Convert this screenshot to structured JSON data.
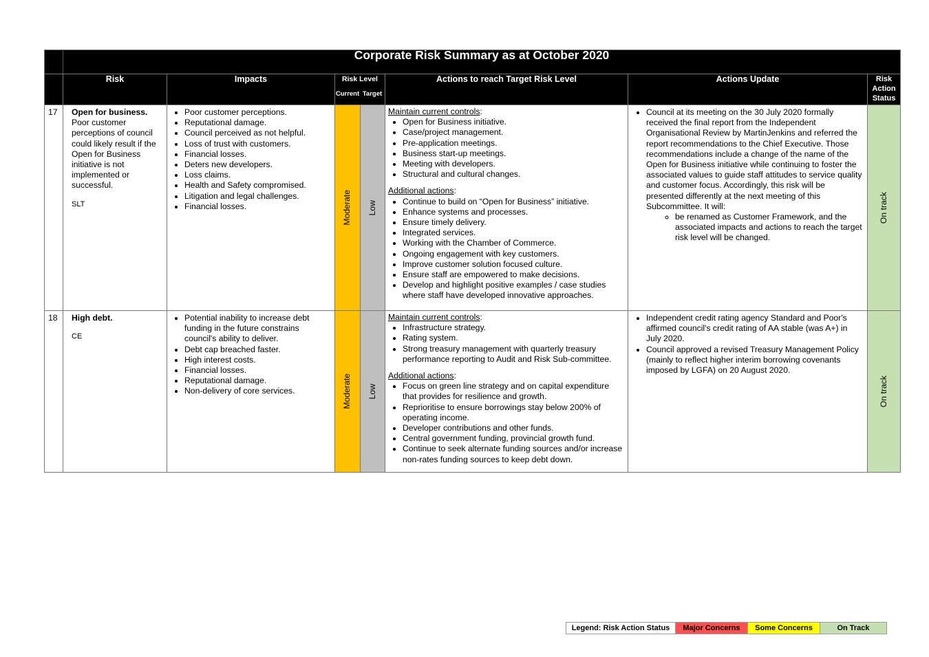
{
  "title": "Corporate Risk Summary as at October 2020",
  "headers": {
    "risk": "Risk",
    "impacts": "Impacts",
    "risk_level": "Risk Level",
    "current": "Current",
    "target": "Target",
    "actions": "Actions to reach Target Risk Level",
    "update": "Actions Update",
    "status": "Risk Action Status"
  },
  "rows": [
    {
      "number": "17",
      "risk_title": "Open for business.",
      "risk_desc": "Poor customer perceptions of council could likely result if the Open for Business initiative is not implemented or successful.",
      "owner": "SLT",
      "impacts": [
        "Poor customer perceptions.",
        "Reputational damage.",
        "Council perceived as not helpful.",
        "Loss of trust with customers.",
        "Financial losses.",
        "Deters new developers.",
        "Loss claims.",
        "Health and Safety compromised.",
        "Litigation and legal challenges.",
        "Financial losses."
      ],
      "current": "Moderate",
      "target": "Low",
      "controls_label": "Maintain current controls",
      "controls": [
        "Open for Business initiative.",
        "Case/project management.",
        "Pre-application meetings.",
        "Business start-up meetings.",
        "Meeting with developers.",
        "Structural and cultural changes."
      ],
      "additional_label": "Additional actions",
      "additional": [
        "Continue to build on “Open for Business” initiative.",
        "Enhance systems and processes.",
        "Ensure timely delivery.",
        "Integrated services.",
        "Working with the Chamber of Commerce.",
        "Ongoing engagement with key customers.",
        "Improve customer solution focused culture.",
        "Ensure staff are empowered to make decisions.",
        "Develop and highlight positive examples / case studies where staff have developed innovative approaches."
      ],
      "updates": [
        "Council at its meeting on the 30 July 2020 formally received the final report from the Independent Organisational Review by MartinJenkins and referred the report recommendations to the Chief Executive. Those recommendations include a change of the name of the Open for Business initiative while continuing to foster the associated values to guide staff attitudes to service quality and customer focus. Accordingly, this risk will be presented differently at the next meeting of this Subcommittee.  It will:"
      ],
      "sub_updates": [
        "be renamed as Customer Framework, and the associated impacts and actions to reach the target risk level will be changed."
      ],
      "status": "On track"
    },
    {
      "number": "18",
      "risk_title": "High debt.",
      "risk_desc": "",
      "owner": "CE",
      "impacts": [
        "Potential inability to increase debt funding in the future constrains council's ability to deliver.",
        "Debt cap breached faster.",
        "High interest costs.",
        "Financial losses.",
        "Reputational damage.",
        "Non-delivery of core services."
      ],
      "current": "Moderate",
      "target": "Low",
      "controls_label": "Maintain current controls",
      "controls": [
        "Infrastructure strategy.",
        "Rating system.",
        "Strong treasury management with quarterly treasury performance reporting to Audit and Risk Sub-committee."
      ],
      "additional_label": "Additional actions",
      "additional": [
        "Focus on green line strategy and on capital expenditure that provides for resilience and growth.",
        "Reprioritise to ensure borrowings stay below 200% of operating income.",
        "Developer contributions and other funds.",
        "Central government funding, provincial growth fund.",
        "Continue to seek alternate funding sources and/or increase non-rates funding sources to keep debt down."
      ],
      "updates": [
        "Independent credit rating agency Standard and Poor's affirmed council's credit rating of AA stable (was A+) in July 2020.",
        "Council approved a revised Treasury Management Policy (mainly to reflect higher interim borrowing covenants imposed by LGFA) on 20 August 2020."
      ],
      "sub_updates": [],
      "status": "On track"
    }
  ],
  "legend": {
    "label": "Legend: Risk Action Status",
    "items": [
      {
        "label": "Major Concerns",
        "color": "#ff5050"
      },
      {
        "label": "Some Concerns",
        "color": "#ffff00"
      },
      {
        "label": "On Track",
        "color": "#c6e0b4"
      }
    ]
  },
  "colors": {
    "moderate": "#ffc000",
    "low": "#bfbfbf",
    "on_track": "#c6e0b4"
  }
}
